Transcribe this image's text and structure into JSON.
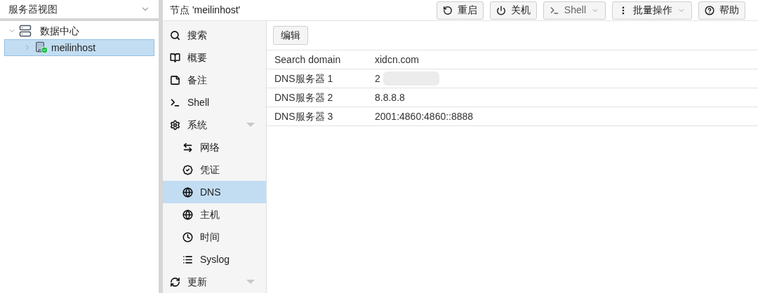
{
  "view_selector": {
    "value": "服务器视图"
  },
  "tree": [
    {
      "label": "数据中心",
      "kind": "datacenter",
      "expanded": true,
      "selected": false,
      "children": [
        {
          "label": "meilinhost",
          "kind": "node",
          "expanded": false,
          "selected": true
        }
      ]
    }
  ],
  "header": {
    "title": "节点 'meilinhost'"
  },
  "toolbar": [
    {
      "label": "重启",
      "kind": "reboot"
    },
    {
      "label": "关机",
      "kind": "shutdown"
    },
    {
      "label": "Shell",
      "kind": "shell"
    },
    {
      "label": "批量操作",
      "kind": "bulk"
    },
    {
      "label": "帮助",
      "kind": "help"
    }
  ],
  "nav": [
    {
      "label": "搜索",
      "kind": "item",
      "selected": false
    },
    {
      "label": "概要",
      "kind": "item",
      "selected": false
    },
    {
      "label": "备注",
      "kind": "item",
      "selected": false
    },
    {
      "label": "Shell",
      "kind": "item",
      "selected": false
    },
    {
      "label": "系统",
      "kind": "group",
      "selected": false,
      "children": [
        {
          "label": "网络",
          "selected": false
        },
        {
          "label": "凭证",
          "selected": false
        },
        {
          "label": "DNS",
          "selected": true
        },
        {
          "label": "主机",
          "selected": false
        },
        {
          "label": "时间",
          "selected": false
        },
        {
          "label": "Syslog",
          "selected": false
        }
      ]
    },
    {
      "label": "更新",
      "kind": "group",
      "selected": false
    }
  ],
  "content": {
    "edit_button": "编辑",
    "rows": [
      {
        "label": "Search domain",
        "value": "xidcn.com",
        "redacted": false
      },
      {
        "label": "DNS服务器 1",
        "value": "2",
        "redacted": true
      },
      {
        "label": "DNS服务器 2",
        "value": "8.8.8.8",
        "redacted": false
      },
      {
        "label": "DNS服务器 3",
        "value": "2001:4860:4860::8888",
        "redacted": false
      }
    ]
  }
}
